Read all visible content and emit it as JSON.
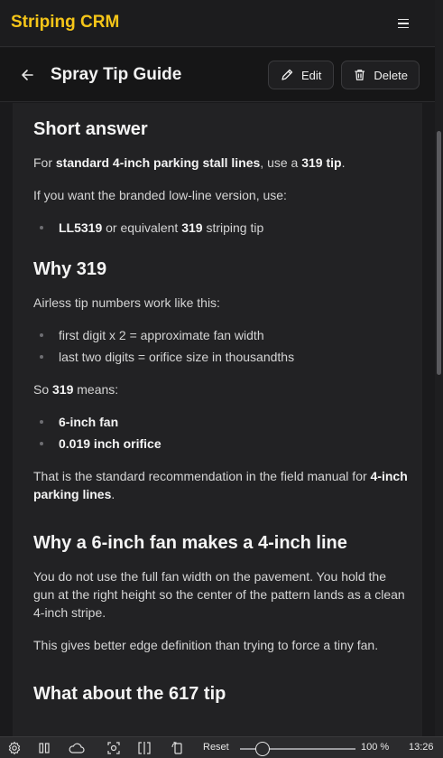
{
  "app": {
    "brand": "Striping CRM"
  },
  "subheader": {
    "title": "Spray Tip Guide",
    "edit_label": "Edit",
    "delete_label": "Delete"
  },
  "article": {
    "short_answer": {
      "heading": "Short answer",
      "p1_pre": "For ",
      "p1_b1": "standard 4-inch parking stall lines",
      "p1_mid": ", use a ",
      "p1_b2": "319 tip",
      "p1_post": ".",
      "p2": "If you want the branded low-line version, use:",
      "bullet_b1": "LL5319",
      "bullet_mid": " or equivalent ",
      "bullet_b2": "319",
      "bullet_post": " striping tip"
    },
    "why_319": {
      "heading": "Why 319",
      "p1": "Airless tip numbers work like this:",
      "bullets": [
        "first digit x 2 = approximate fan width",
        "last two digits = orifice size in thousandths"
      ],
      "p2_pre": "So ",
      "p2_b": "319",
      "p2_post": " means:",
      "bold_bullets": [
        "6-inch fan",
        "0.019 inch orifice"
      ],
      "p3_pre": "That is the standard recommendation in the field manual for ",
      "p3_b": "4-inch parking lines",
      "p3_post": "."
    },
    "why_fan": {
      "heading": "Why a 6-inch fan makes a 4-inch line",
      "p1": "You do not use the full fan width on the pavement. You hold the gun at the right height so the center of the pattern lands as a clean 4-inch stripe.",
      "p2": "This gives better edge definition than trying to force a tiny fan."
    },
    "what_617": {
      "heading": "What about the 617 tip"
    }
  },
  "taskbar": {
    "reset_label": "Reset",
    "zoom_text": "100 %",
    "clock": "13:26",
    "zoom_value": 0.15
  }
}
